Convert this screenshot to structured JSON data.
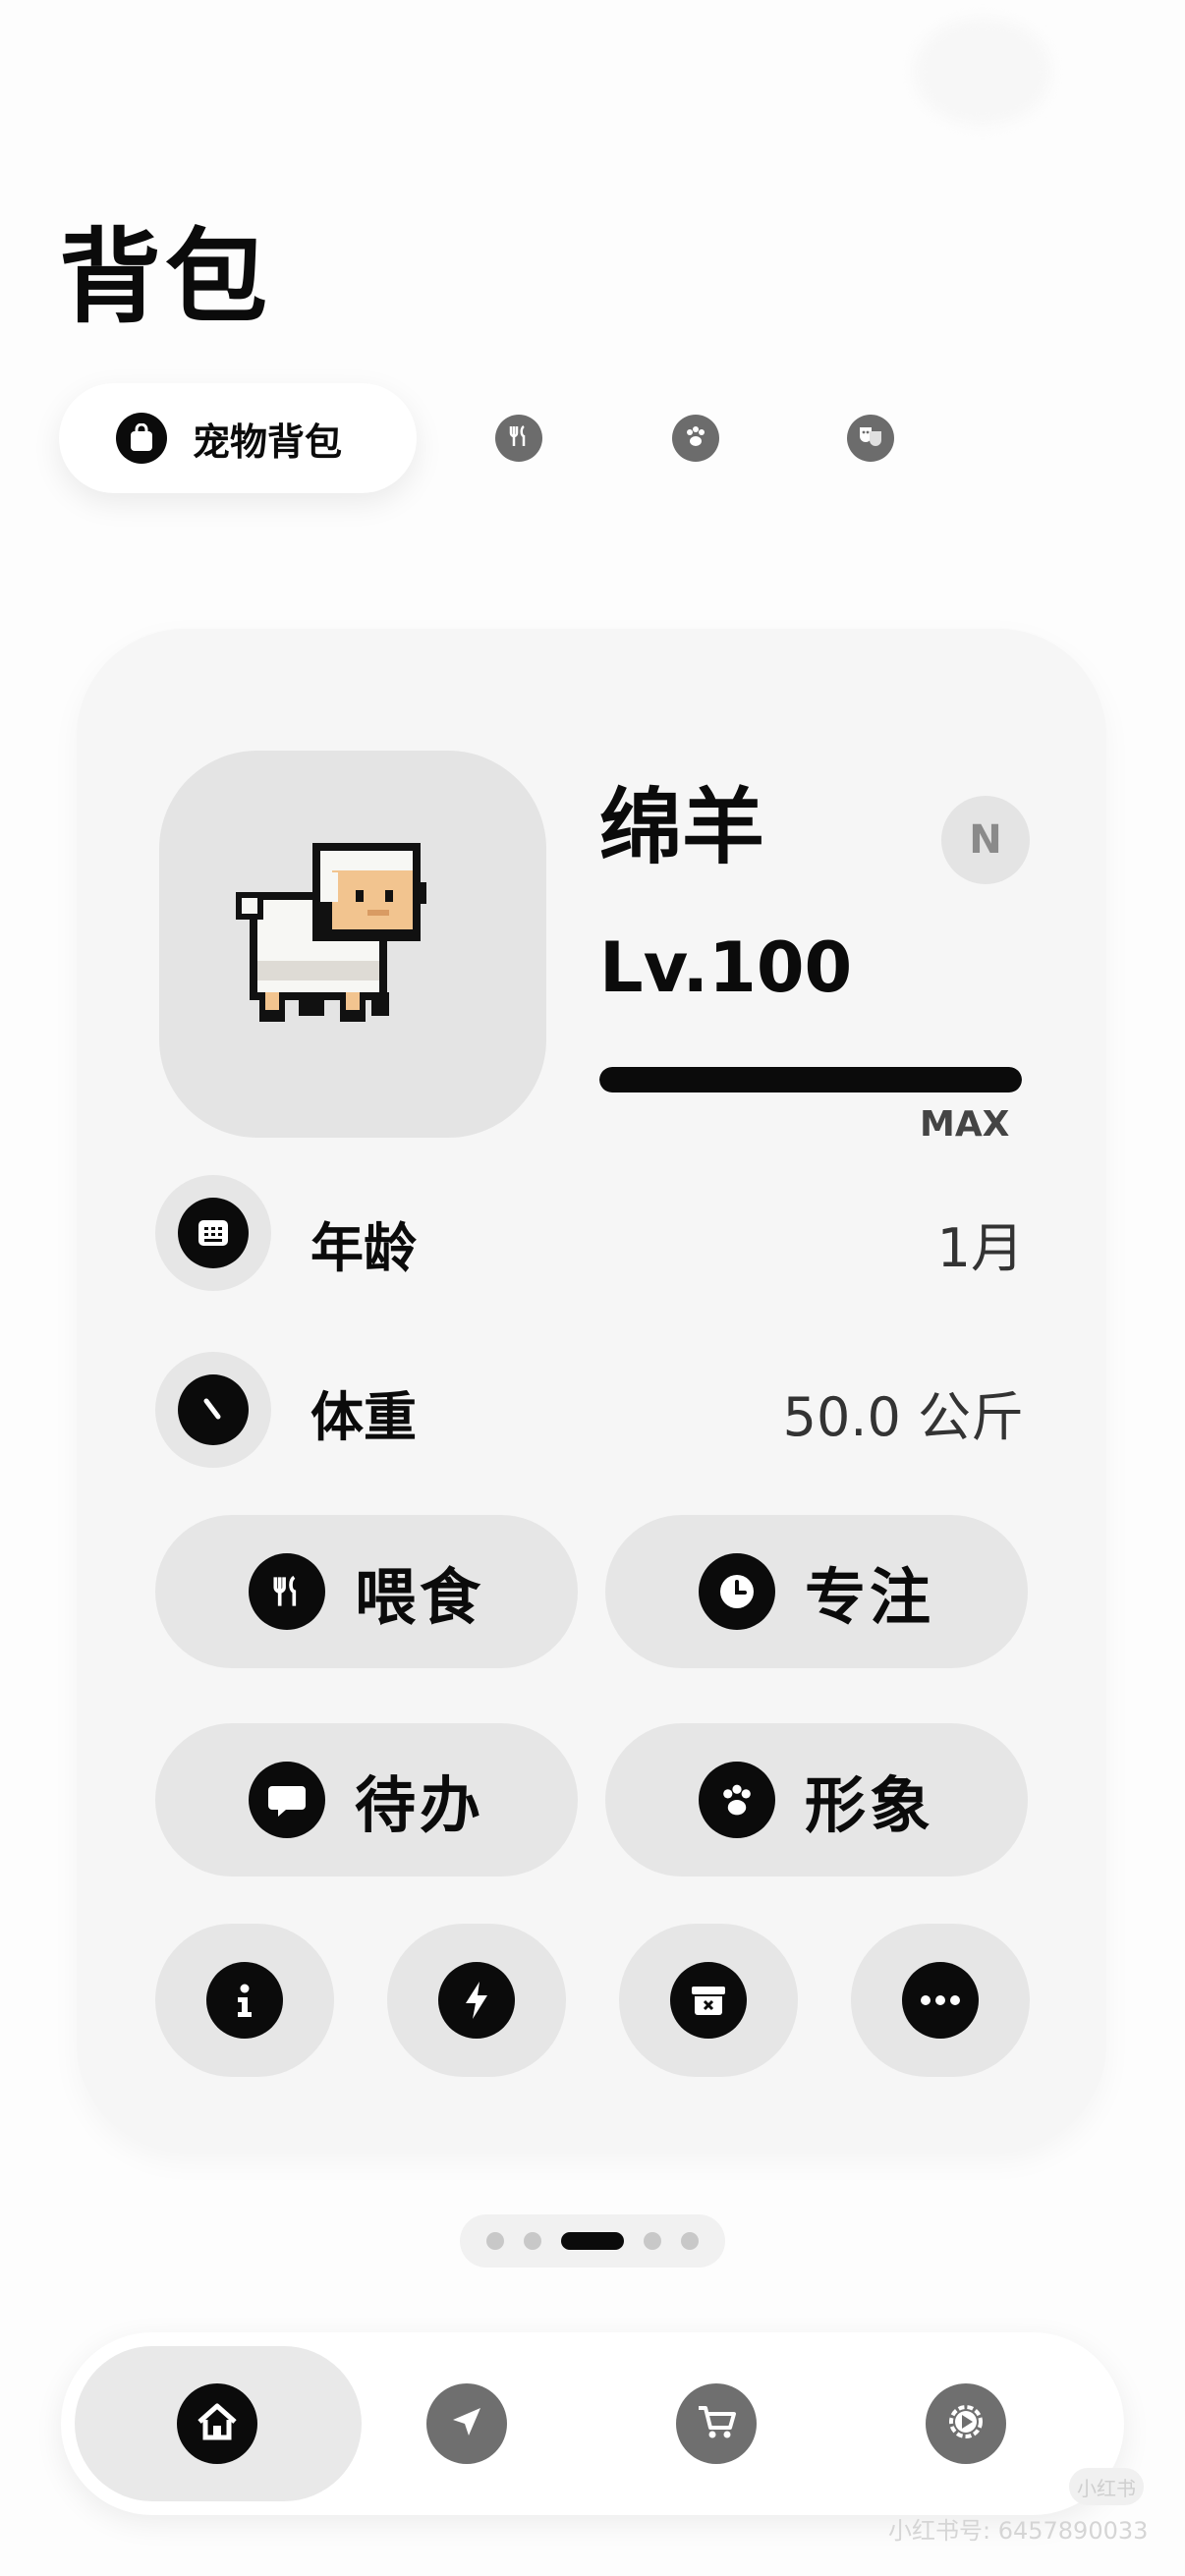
{
  "header": {
    "title": "背包"
  },
  "tabs": [
    {
      "label": "宠物背包",
      "icon": "bag-icon",
      "active": true
    },
    {
      "icon": "utensils-icon"
    },
    {
      "icon": "paw-icon"
    },
    {
      "icon": "theater-masks-icon"
    }
  ],
  "pet": {
    "name": "绵羊",
    "rarity": "N",
    "level": "Lv.100",
    "progress": 1.0,
    "progress_label": "MAX"
  },
  "stats": [
    {
      "label": "年龄",
      "value": "1月",
      "icon": "calendar-icon"
    },
    {
      "label": "体重",
      "value": "50.0 公斤",
      "icon": "gauge-icon"
    }
  ],
  "actions": [
    {
      "label": "喂食",
      "icon": "utensils-icon"
    },
    {
      "label": "专注",
      "icon": "clock-icon"
    },
    {
      "label": "待办",
      "icon": "chat-bubble-icon"
    },
    {
      "label": "形象",
      "icon": "paw-icon"
    }
  ],
  "small_actions": [
    {
      "icon": "info-icon"
    },
    {
      "icon": "lightning-icon"
    },
    {
      "icon": "archive-box-icon"
    },
    {
      "icon": "more-icon"
    }
  ],
  "pagination": {
    "total": 5,
    "current": 3
  },
  "bottom_nav": [
    {
      "icon": "home-icon",
      "active": true
    },
    {
      "icon": "navigation-arrow-icon"
    },
    {
      "icon": "cart-icon"
    },
    {
      "icon": "play-gear-icon"
    }
  ],
  "watermark": {
    "text": "小红书号: 6457890033",
    "badge": "小红书"
  },
  "colors": {
    "primary": "#0b0b0b",
    "surface": "#f6f6f6",
    "chip": "#e6e6e6",
    "muted_icon": "#6c6c6c"
  }
}
